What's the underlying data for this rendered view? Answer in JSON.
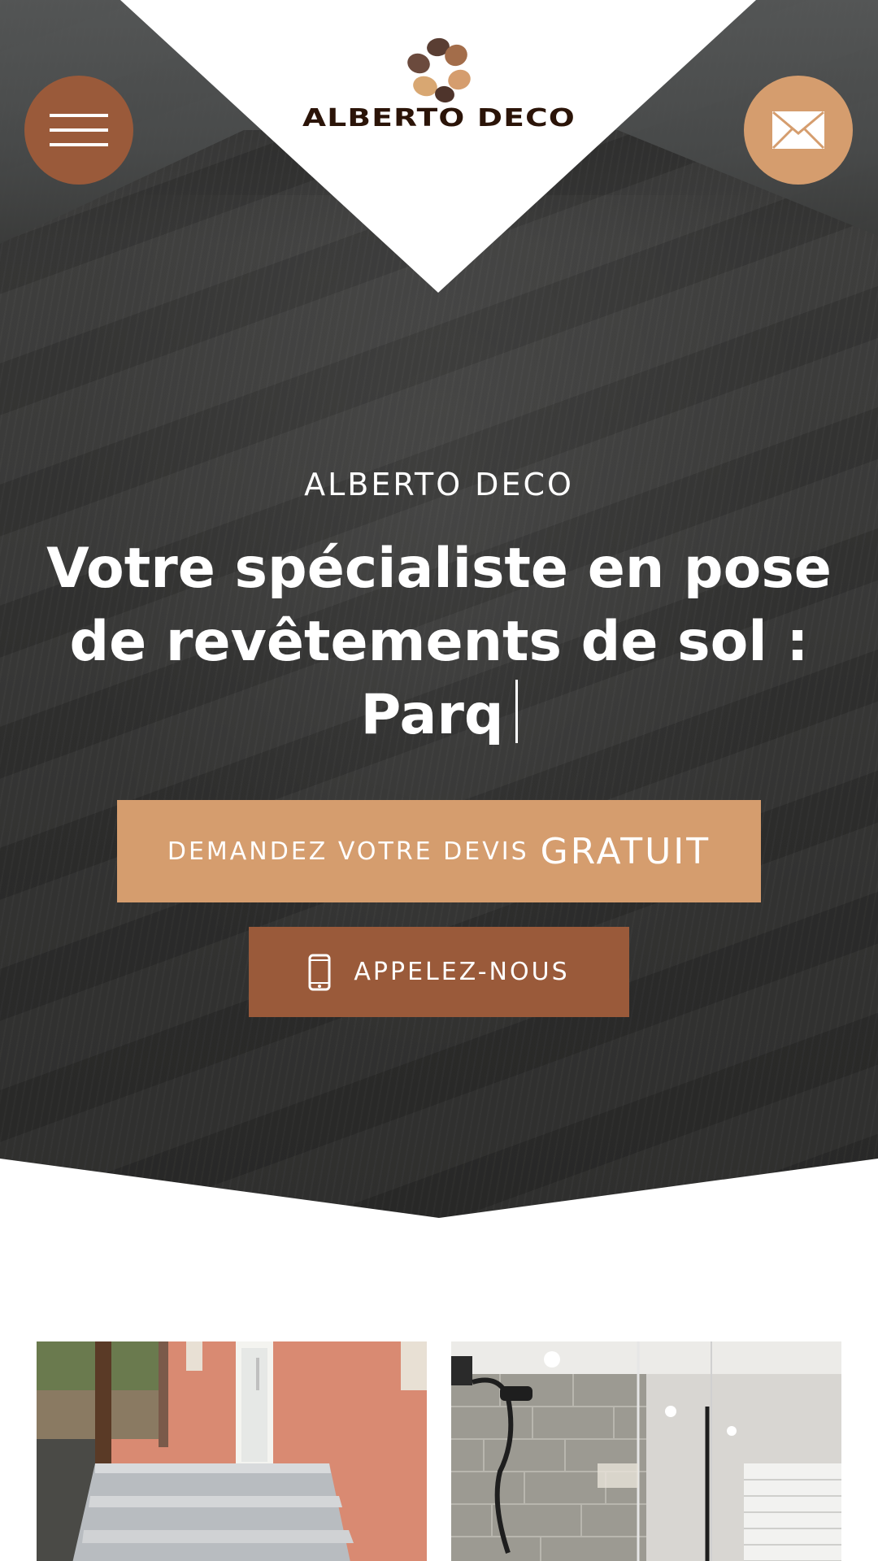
{
  "brand": {
    "logo_text": "ALBERTO DECO",
    "primary_color": "#d59d6e",
    "secondary_color": "#9a5a3a",
    "dark_text_color": "#2b1408"
  },
  "header": {
    "menu_icon": "hamburger-icon",
    "mail_icon": "envelope-icon"
  },
  "hero": {
    "eyebrow": "ALBERTO DECO",
    "headline": "Votre spécialiste en pose de revêtements de sol :",
    "typed_text": "Parq",
    "cta_devis_small": "DEMANDEZ VOTRE DEVIS",
    "cta_devis_big": "GRATUIT",
    "cta_call_label": "APPELEZ-NOUS",
    "cta_call_icon": "mobile-phone-icon"
  },
  "gallery": {
    "items": [
      {
        "name": "exterior-stairs-photo"
      },
      {
        "name": "shower-bathroom-photo"
      }
    ]
  }
}
